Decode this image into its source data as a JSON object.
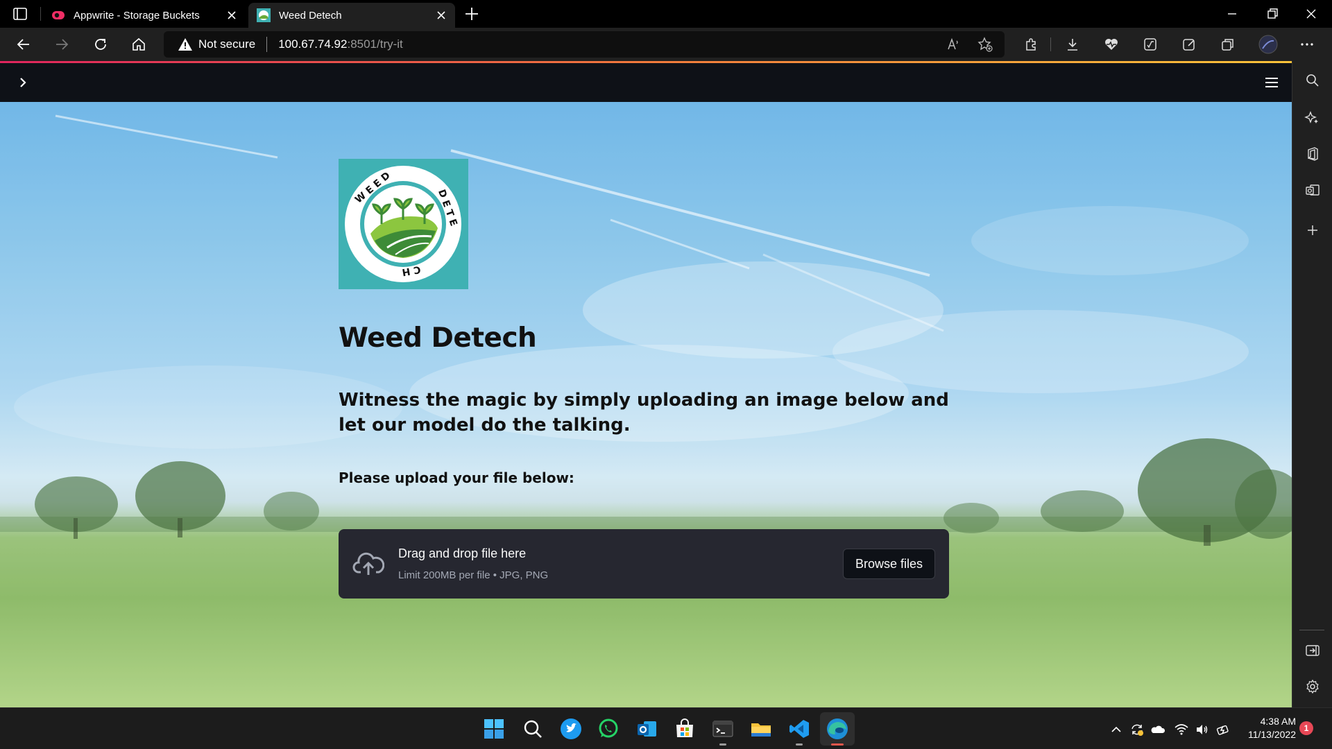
{
  "browser": {
    "tabs": [
      {
        "title": "Appwrite - Storage Buckets",
        "favicon": "appwrite-icon",
        "active": false
      },
      {
        "title": "Weed Detech",
        "favicon": "weed-detech-favicon",
        "active": true
      }
    ],
    "address_bar": {
      "security_label": "Not secure",
      "url_host": "100.67.74.92",
      "url_rest": ":8501/try-it"
    }
  },
  "page": {
    "logo": {
      "ring_text": "WEED DETECH",
      "colors": {
        "background": "#3fb1b3",
        "ring": "#ffffff",
        "border": "#3fb1b3",
        "leaf_light": "#8cc63f",
        "leaf_dark": "#3d8b37"
      }
    },
    "title": "Weed Detech",
    "subtitle": "Witness the magic by simply uploading an image below and let our model do the talking.",
    "upload_label": "Please upload your file below:",
    "uploader": {
      "drop_text": "Drag and drop file here",
      "limit_text": "Limit 200MB per file • JPG, PNG",
      "button_label": "Browse files"
    }
  },
  "taskbar": {
    "apps": [
      "windows-start",
      "search",
      "twitter",
      "whatsapp",
      "outlook",
      "microsoft-store",
      "terminal",
      "file-explorer",
      "vscode",
      "edge"
    ],
    "clock": {
      "time": "4:38 AM",
      "date": "11/13/2022"
    },
    "notification_count": "1"
  },
  "colors": {
    "streamlit_header": "#0e1117",
    "uploader_bg": "#262730",
    "accent_gradient": [
      "#e0245e",
      "#f27a3c",
      "#f8c33a"
    ]
  }
}
